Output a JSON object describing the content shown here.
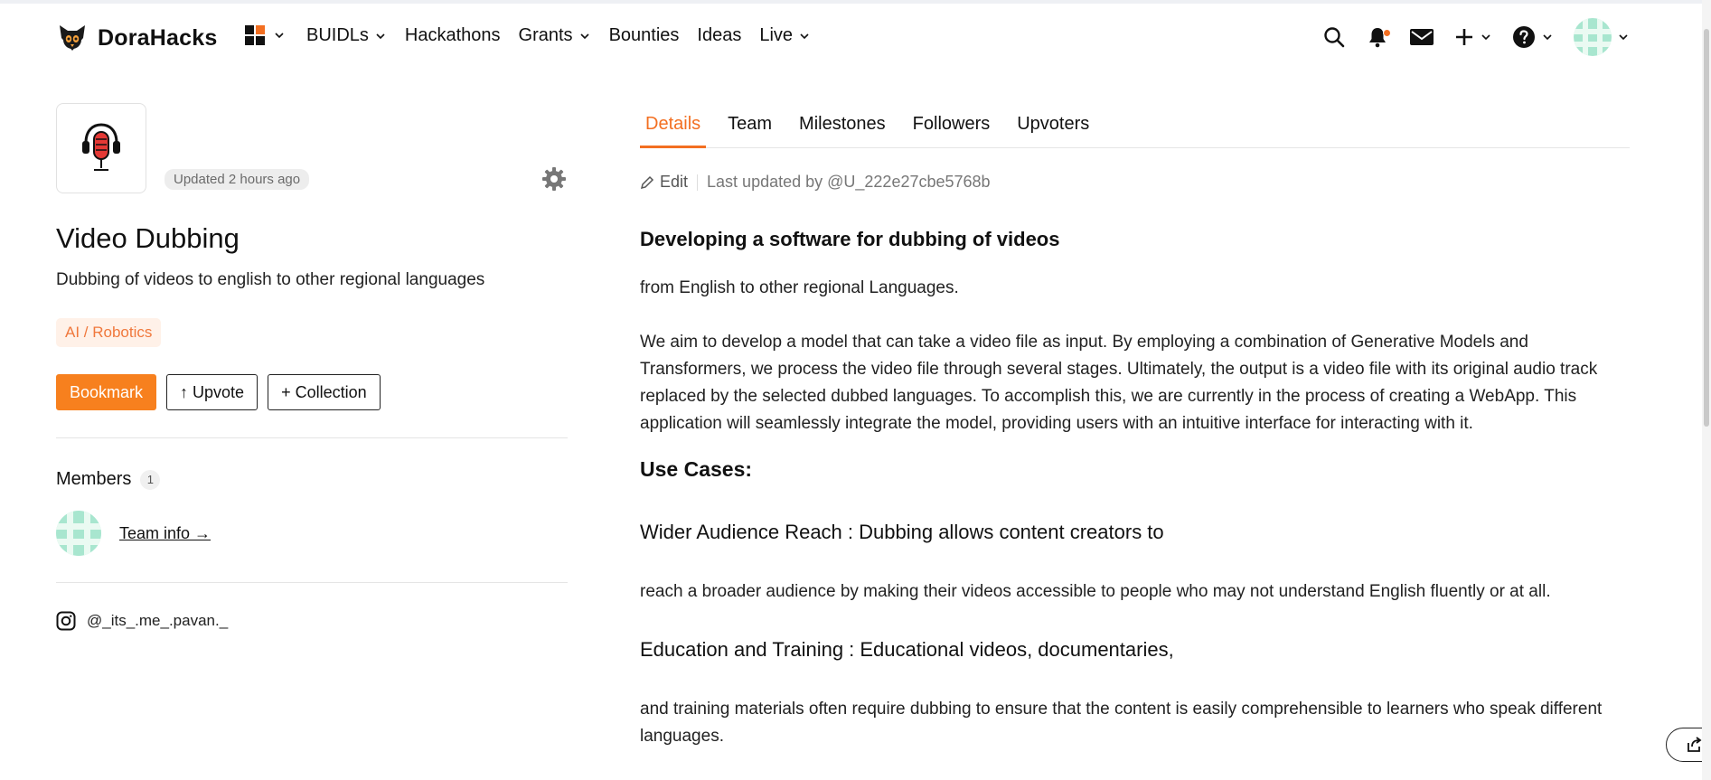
{
  "header": {
    "brand": "DoraHacks",
    "nav_links": [
      "BUIDLs",
      "Hackathons",
      "Grants",
      "Bounties",
      "Ideas",
      "Live"
    ],
    "icons": [
      "apps-grid-icon",
      "search-icon",
      "bell-icon",
      "mail-icon",
      "plus-icon",
      "help-icon"
    ],
    "accent_color": "#f36f21"
  },
  "project": {
    "updated": "Updated 2 hours ago",
    "title": "Video Dubbing",
    "subtitle": "Dubbing of videos to english to other regional languages",
    "tag": "AI / Robotics",
    "buttons": {
      "bookmark": "Bookmark",
      "upvote": "↑ Upvote",
      "collection": "+ Collection"
    },
    "members_title": "Members",
    "members_count": "1",
    "team_link": "Team info →",
    "social_handle": "@_its_.me_.pavan._"
  },
  "tabs": [
    "Details",
    "Team",
    "Milestones",
    "Followers",
    "Upvoters"
  ],
  "active_tab": "Details",
  "edit": {
    "label": "Edit",
    "last_updated": "Last updated by @U_222e27cbe5768b"
  },
  "details": {
    "heading": "Developing a software for dubbing of videos",
    "intro": "from English to other regional Languages.",
    "paragraph": "We aim to develop a model that can take a video file as input. By employing a combination of Generative Models and Transformers, we process the video file through several stages. Ultimately, the output is a video file with its original audio track replaced by the selected dubbed languages. To accomplish this, we are currently in the process of creating a WebApp. This application will seamlessly integrate the model, providing users with an intuitive interface for interacting with it.",
    "use_cases_heading": "Use Cases:",
    "use_case_1_title": "Wider Audience Reach : Dubbing allows content creators to",
    "use_case_1_text": "reach a broader audience by making their videos accessible to people who may not understand English fluently or at all.",
    "use_case_2_title": "Education and Training : Educational videos, documentaries,",
    "use_case_2_text": "and training materials often require dubbing to ensure that the content is easily comprehensible to learners who speak different languages."
  }
}
